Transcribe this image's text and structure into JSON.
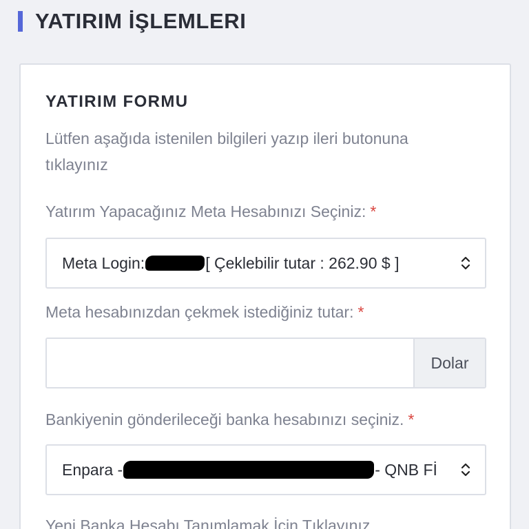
{
  "header": {
    "title": "YATIRIM İŞLEMLERI"
  },
  "form": {
    "title": "YATIRIM FORMU",
    "description": "Lütfen aşağıda istenilen bilgileri yazıp ileri butonuna tıklayınız",
    "meta_account": {
      "label": "Yatırım Yapacağınız Meta Hesabınızı Seçiniz:",
      "required": "*",
      "selected_prefix": "Meta Login:",
      "selected_suffix": "[ Çeklebilir tutar : 262.90 $ ]"
    },
    "amount": {
      "label": "Meta hesabınızdan çekmek istediğiniz tutar:",
      "required": "*",
      "value": "",
      "currency": "Dolar"
    },
    "bank_account": {
      "label": "Bankiyenin gönderileceği banka hesabınızı seçiniz.",
      "required": "*",
      "selected_prefix": "Enpara - ",
      "selected_suffix": "- QNB Fİ"
    },
    "new_bank_link": "Yeni Banka Hesabı Tanımlamak İçin Tıklayınız"
  },
  "icons": {
    "select": "chevron-up-down-icon"
  },
  "colors": {
    "accent": "#5567d8",
    "required": "#d9453f",
    "background": "#f0f1f5"
  }
}
